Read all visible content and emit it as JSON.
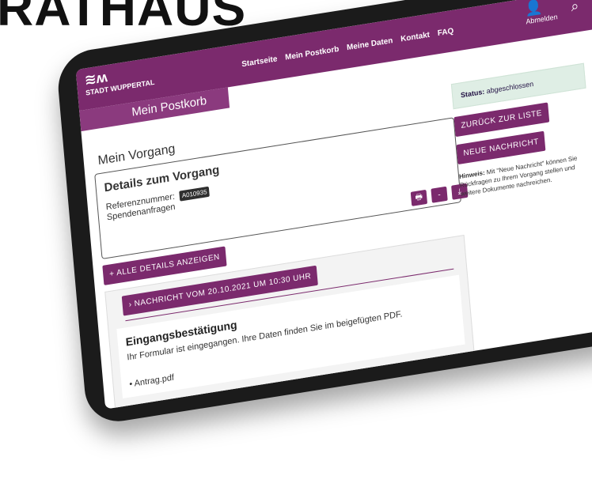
{
  "headline": "RATHAUS",
  "header": {
    "logo_mark": "≋ʍ",
    "logo_name": "STADT WUPPERTAL",
    "nav": [
      "Startseite",
      "Mein Postkorb",
      "Meine Daten",
      "Kontakt",
      "FAQ"
    ],
    "logout_label": "Abmelden",
    "icons": {
      "user": "user-icon",
      "search": "search-icon"
    }
  },
  "tab": {
    "label": "Mein Postkorb"
  },
  "main": {
    "title": "Mein Vorgang",
    "details_title": "Details zum Vorgang",
    "ref_label": "Referenznummer:",
    "ref_value": "A010935",
    "type": "Spendenanfragen",
    "all_details": "ALLE DETAILS ANZEIGEN",
    "message_btn": "NACHRICHT VOM 20.10.2021 UM 10:30 UHR",
    "message_title": "Eingangsbestätigung",
    "message_text": "Ihr Formular ist eingegangen. Ihre Daten finden Sie im beigefügten PDF.",
    "attachment": "Antrag.pdf",
    "btn_print": "🖶",
    "btn_dash": "-",
    "btn_download": "⤓"
  },
  "sidebar": {
    "status_label": "Status:",
    "status_value": "abgeschlossen",
    "back_btn": "ZURÜCK ZUR LISTE",
    "new_btn": "NEUE NACHRICHT",
    "hint_label": "Hinweis:",
    "hint_text": "Mit \"Neue Nachricht\" können Sie Rückfragen zu Ihrem Vorgang stellen und weitere Dokumente nachreichen."
  }
}
